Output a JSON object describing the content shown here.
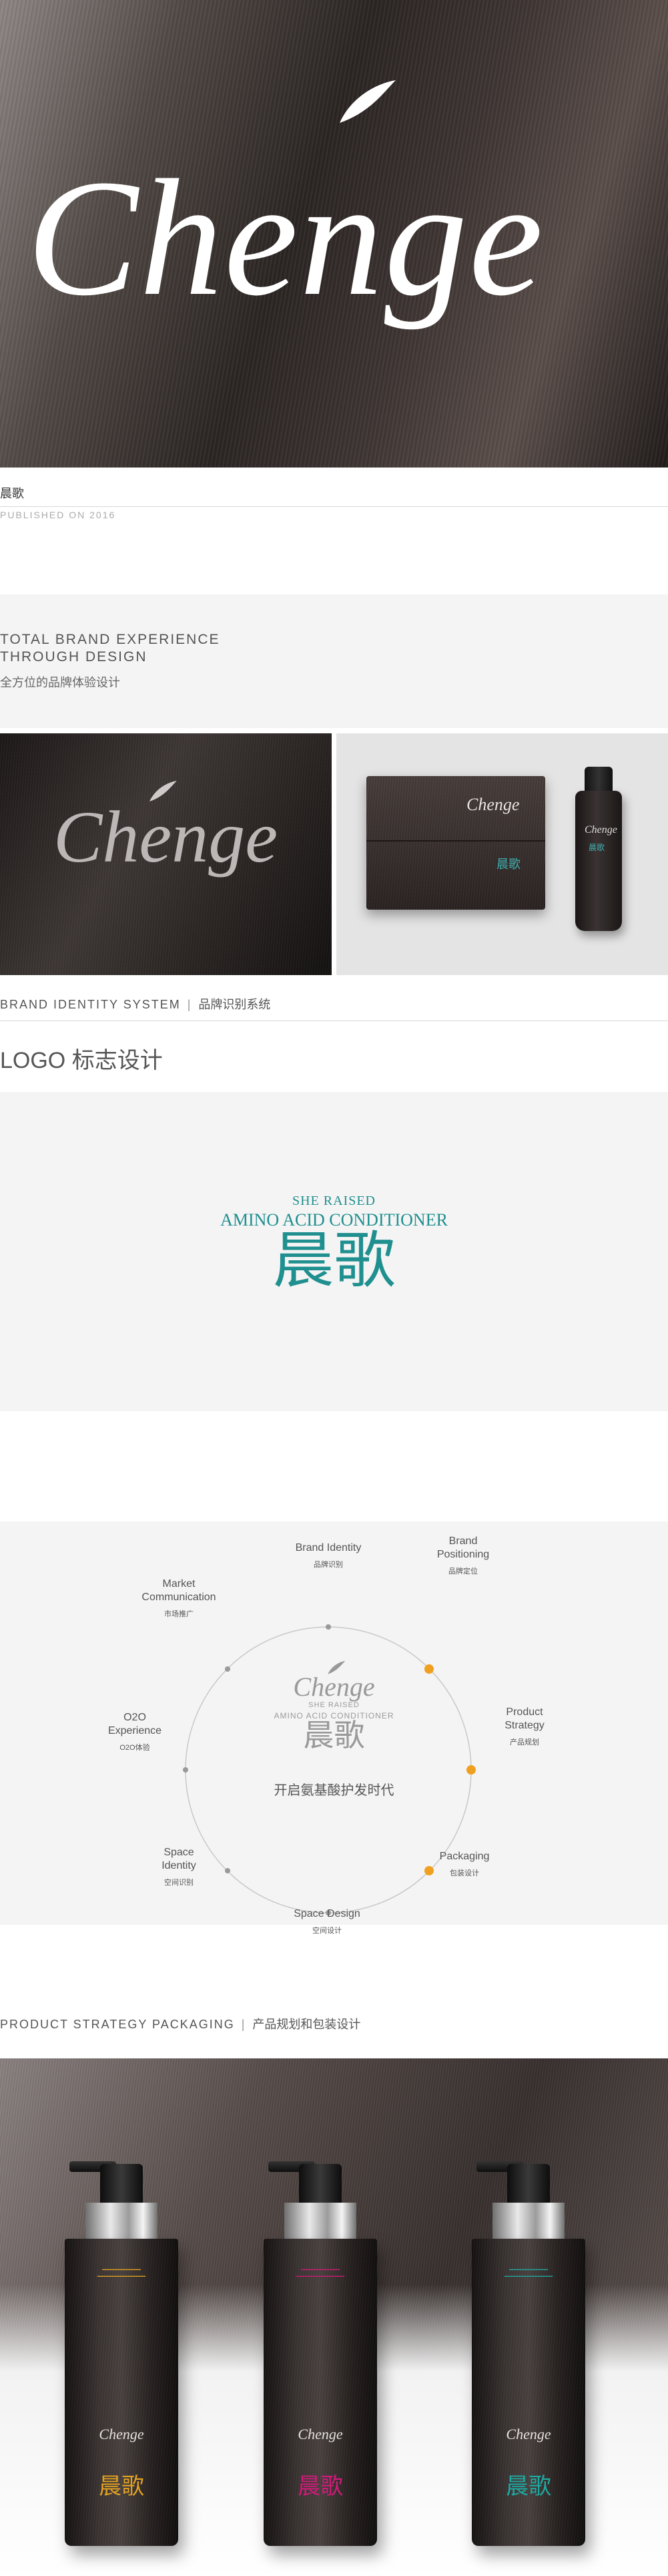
{
  "hero": {
    "logo_text": "Chenge"
  },
  "publication": {
    "title": "晨歌",
    "subtitle": "PUBLISHED ON 2016"
  },
  "experience": {
    "title": "TOTAL BRAND EXPERIENCE THROUGH DESIGN",
    "subtitle": "全方位的品牌体验设计"
  },
  "photos": {
    "left_logo": "Chenge",
    "box_logo": "Chenge",
    "box_cn": "晨歌",
    "bottle_logo": "Chenge",
    "bottle_cn": "晨歌"
  },
  "sections": {
    "brand_identity": {
      "en": "BRAND IDENTITY SYSTEM",
      "sep": "|",
      "cn": "品牌识别系统"
    },
    "packaging": {
      "en": "PRODUCT STRATEGY PACKAGING",
      "sep": "|",
      "cn": "产品规划和包装设计"
    }
  },
  "logo_section": {
    "title": "LOGO 标志设计",
    "line1": "SHE RAISED",
    "line2": "AMINO ACID CONDITIONER",
    "cn": "晨歌",
    "color": "#1f8f8f"
  },
  "diagram": {
    "center_logo": "Chenge",
    "center_line1": "SHE RAISED",
    "center_line2": "AMINO ACID CONDITIONER",
    "center_cn": "晨歌",
    "slogan": "开启氨基酸护发时代",
    "accent_color": "#f0a020",
    "nodes": [
      {
        "en": "Brand Identity",
        "cn": "品牌识别"
      },
      {
        "en": "Brand Positioning",
        "cn": "品牌定位"
      },
      {
        "en": "Product Strategy",
        "cn": "产品规划"
      },
      {
        "en": "Packaging",
        "cn": "包装设计"
      },
      {
        "en": "Space Design",
        "cn": "空间设计"
      },
      {
        "en": "Space Identity",
        "cn": "空间识别"
      },
      {
        "en": "O2O Experience",
        "cn": "O2O体验"
      },
      {
        "en": "Market Communication",
        "cn": "市场推广"
      }
    ]
  },
  "products": [
    {
      "logo": "Chenge",
      "cn": "晨歌",
      "accent": "#e0a020"
    },
    {
      "logo": "Chenge",
      "cn": "晨歌",
      "accent": "#d01a78"
    },
    {
      "logo": "Chenge",
      "cn": "晨歌",
      "accent": "#1fa8a0"
    }
  ]
}
